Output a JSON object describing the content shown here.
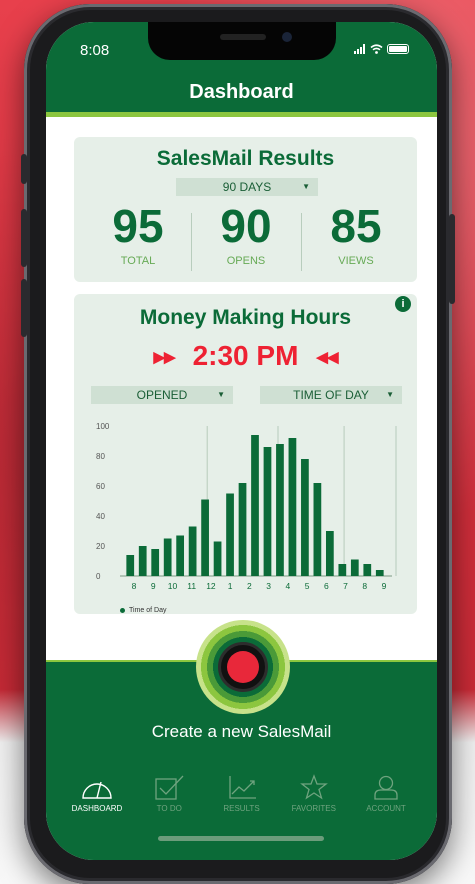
{
  "status": {
    "time": "8:08",
    "signal": "..ıl"
  },
  "header": {
    "title": "Dashboard"
  },
  "results": {
    "title": "SalesMail Results",
    "period": "90 DAYS",
    "stats": [
      {
        "value": "95",
        "label": "TOTAL"
      },
      {
        "value": "90",
        "label": "OPENS"
      },
      {
        "value": "85",
        "label": "VIEWS"
      }
    ]
  },
  "hours": {
    "title": "Money Making Hours",
    "info": "i",
    "peak_time": "2:30 PM",
    "left_arrows": "▶▶",
    "right_arrows": "◀◀",
    "filter_metric": "OPENED",
    "filter_dimension": "TIME OF DAY",
    "legend": "Time of Day"
  },
  "chart_data": {
    "type": "bar",
    "xlabel": "",
    "ylabel": "",
    "legend": [
      "Time of Day"
    ],
    "ylim": [
      0,
      100
    ],
    "yticks": [
      0,
      20,
      40,
      60,
      80,
      100
    ],
    "xticks": [
      "8",
      "9",
      "10",
      "11",
      "12",
      "1",
      "2",
      "3",
      "4",
      "5",
      "6",
      "7",
      "8",
      "9"
    ],
    "values": [
      14,
      20,
      18,
      25,
      27,
      33,
      51,
      23,
      55,
      62,
      94,
      86,
      88,
      92,
      78,
      62,
      30,
      8,
      11,
      8,
      4
    ],
    "color": "#0b6b38"
  },
  "cta": {
    "label": "Create a new SalesMail"
  },
  "tabs": [
    {
      "label": "DASHBOARD",
      "icon": "gauge-icon",
      "active": true
    },
    {
      "label": "TO DO",
      "icon": "checkbox-icon",
      "active": false
    },
    {
      "label": "RESULTS",
      "icon": "trend-chart-icon",
      "active": false
    },
    {
      "label": "FAVORITES",
      "icon": "star-icon",
      "active": false
    },
    {
      "label": "ACCOUNT",
      "icon": "person-icon",
      "active": false
    }
  ],
  "colors": {
    "brand": "#0b6b38",
    "accent": "#8cc63f",
    "alert": "#ee2233",
    "card": "#e6efe8"
  }
}
